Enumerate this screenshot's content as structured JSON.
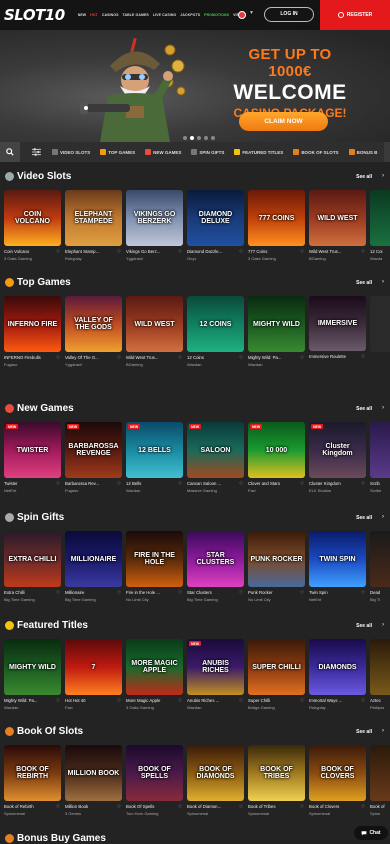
{
  "header": {
    "logo": "SLOT10",
    "nav": [
      "NEW",
      "HOT",
      "CASINOS",
      "TABLE GAMES",
      "LIVE CASINO",
      "JACKPOTS",
      "PROMOTIONS",
      "VIP"
    ],
    "login": "LOG IN",
    "register": "REGISTER"
  },
  "hero": {
    "line1": "GET UP TO 1000€",
    "line2": "WELCOME",
    "line3": "CASINO PACKAGE!",
    "cta": "CLAIM NOW"
  },
  "categories": [
    "VIDEO SLOTS",
    "TOP GAMES",
    "NEW GAMES",
    "SPIN GIFTS",
    "FEATURED TITLES",
    "BOOK OF SLOTS",
    "BONUS B"
  ],
  "see_all": "See all",
  "sections": [
    {
      "title": "Video Slots",
      "icon_color": "#9aa",
      "games": [
        {
          "thumb": "COIN VOLCANO",
          "name": "Coin Volcano",
          "provider": "3 Oaks Gaming",
          "bg": "linear-gradient(#5a1a10,#c03a12,#ffb020)"
        },
        {
          "thumb": "ELEPHANT STAMPEDE",
          "name": "Elephant Stamp...",
          "provider": "Rubyplay",
          "bg": "linear-gradient(#6a3a1a,#c07830,#e0a040)"
        },
        {
          "thumb": "VIKINGS GO BERZERK",
          "name": "Vikings Go Berz...",
          "provider": "Yggdrasil",
          "bg": "linear-gradient(#3a4a6a,#8090b0,#c0c8d8)"
        },
        {
          "thumb": "DIAMOND DELUXE",
          "name": "Diamond Dazzle...",
          "provider": "Onyx",
          "bg": "linear-gradient(#0a1a3a,#1a3a7a,#2050a0)"
        },
        {
          "thumb": "777 COINS",
          "name": "777 Coins",
          "provider": "3 Oaks Gaming",
          "bg": "linear-gradient(#6a1a08,#c0400a,#ff9020)"
        },
        {
          "thumb": "WILD WEST",
          "name": "Wild West Trus...",
          "provider": "BGaming",
          "bg": "linear-gradient(#5a1a12,#9a3a20,#d07040)"
        },
        {
          "thumb": "12",
          "name": "12 Coi",
          "provider": "Wazda",
          "bg": "linear-gradient(#0a3a20,#1a7040)"
        }
      ]
    },
    {
      "title": "Top Games",
      "icon_color": "#f39c12",
      "games": [
        {
          "thumb": "INFERNO FIRE",
          "name": "INFERNO Firebulls",
          "provider": "Fugaso",
          "bg": "linear-gradient(#3a0a0a,#a01a10,#ff5a10)"
        },
        {
          "thumb": "VALLEY OF THE GODS",
          "name": "Valley Of The G...",
          "provider": "Yggdrasil",
          "bg": "linear-gradient(#5a1a3a,#c04a20,#f0a030)"
        },
        {
          "thumb": "WILD WEST",
          "name": "Wild West Trus...",
          "provider": "BGaming",
          "bg": "linear-gradient(#5a1a12,#9a3a20,#d07040)"
        },
        {
          "thumb": "12 COINS",
          "name": "12 Coins",
          "provider": "Wazdan",
          "bg": "linear-gradient(#0a4a3a,#108060,#20b080)"
        },
        {
          "thumb": "MIGHTY WILD",
          "name": "Mighty Wild: Pa...",
          "provider": "Wazdan",
          "bg": "linear-gradient(#0a2a10,#1a5a20,#3a8a30)"
        },
        {
          "thumb": "IMMERSIVE",
          "name": "Immersive Roulette",
          "provider": "",
          "bg": "linear-gradient(#1a0a1a,#3a2a3a,#6a5a6a)",
          "tall": true
        },
        {
          "thumb": "",
          "name": "",
          "provider": "",
          "bg": "#2a2a2a"
        }
      ]
    },
    {
      "title": "New Games",
      "icon_color": "#e74c3c",
      "games": [
        {
          "thumb": "TWISTER",
          "name": "Twister",
          "provider": "NetEnt",
          "bg": "linear-gradient(#3a0a2a,#a01a5a,#e04080)",
          "new": true
        },
        {
          "thumb": "BARBAROSSA REVENGE",
          "name": "Barbarossa Rev...",
          "provider": "Fugaso",
          "bg": "linear-gradient(#1a0a0a,#5a1a10,#a03a1a)",
          "new": true
        },
        {
          "thumb": "12 BELLS",
          "name": "12 Bells",
          "provider": "Wazdan",
          "bg": "linear-gradient(#0a4a6a,#1a8aa0,#40c0d0)",
          "new": true
        },
        {
          "thumb": "SALOON",
          "name": "Cancan Saloon ...",
          "provider": "Massive Gaming",
          "bg": "linear-gradient(#0a3a3a,#1a6a5a,#a04a20)",
          "new": true
        },
        {
          "thumb": "10 000",
          "name": "Clover and Stars",
          "provider": "Fazi",
          "bg": "linear-gradient(#0a5a1a,#1a9a30,#e0c020)",
          "new": true
        },
        {
          "thumb": "Cluster Kingdom",
          "name": "Cluster Kingdom",
          "provider": "ELK Studios",
          "bg": "linear-gradient(#1a1a2a,#3a2a4a,#6a4a5a)",
          "new": true
        },
        {
          "thumb": "",
          "name": "Scrib",
          "provider": "Scribe",
          "bg": "linear-gradient(#2a1a4a,#5a3a8a)"
        }
      ]
    },
    {
      "title": "Spin Gifts",
      "icon_color": "#aaa",
      "games": [
        {
          "thumb": "EXTRA CHILLI",
          "name": "Extra Chilli",
          "provider": "Big Time Gaming",
          "bg": "linear-gradient(#2a1a2a,#6a2a2a,#c03a1a)"
        },
        {
          "thumb": "MILLIONAIRE",
          "name": "Millionaire",
          "provider": "Big Time Gaming",
          "bg": "linear-gradient(#0a0a3a,#1a1a6a,#3a3aa0)"
        },
        {
          "thumb": "FIRE IN THE HOLE",
          "name": "Fire in the Hole ...",
          "provider": "No Limit City",
          "bg": "linear-gradient(#1a0a0a,#5a2a0a,#d06010)"
        },
        {
          "thumb": "STAR CLUSTERS",
          "name": "Star Clusters",
          "provider": "Big Time Gaming",
          "bg": "linear-gradient(#3a0a5a,#8a1a9a,#e040c0)"
        },
        {
          "thumb": "PUNK ROCKER",
          "name": "Punk Rocker",
          "provider": "No Limit City",
          "bg": "linear-gradient(#3a1a0a,#7a4a2a,#4a6a9a)"
        },
        {
          "thumb": "TWIN SPIN",
          "name": "Twin Spin",
          "provider": "NetEnt",
          "bg": "linear-gradient(#0a1a6a,#1a4ac0,#40a0ff)"
        },
        {
          "thumb": "",
          "name": "Dead",
          "provider": "Big Ti",
          "bg": "linear-gradient(#1a1a1a,#4a2a1a)"
        }
      ]
    },
    {
      "title": "Featured Titles",
      "icon_color": "#f1c40f",
      "games": [
        {
          "thumb": "MIGHTY WILD",
          "name": "Mighty Wild: Pa...",
          "provider": "Wazdan",
          "bg": "linear-gradient(#0a2a10,#1a5a20,#3a8a30)"
        },
        {
          "thumb": "7",
          "name": "Hot Hot 40",
          "provider": "Fazi",
          "bg": "linear-gradient(#5a0a0a,#c01a10,#ff8020)"
        },
        {
          "thumb": "MORE MAGIC APPLE",
          "name": "More Magic Apple",
          "provider": "3 Oaks Gaming",
          "bg": "linear-gradient(#0a3a1a,#1a6a2a,#c02a1a)"
        },
        {
          "thumb": "ANUBIS RICHES",
          "name": "Anubis Riches ...",
          "provider": "Wazdan",
          "bg": "linear-gradient(#1a0a3a,#3a1a6a,#c09020)",
          "new": true
        },
        {
          "thumb": "SUPER CHILLI",
          "name": "Super Chilli",
          "provider": "Bridge Gaming",
          "bg": "linear-gradient(#3a1a0a,#8a3a10,#e07020)"
        },
        {
          "thumb": "DIAMONDS",
          "name": "Immortal Ways ...",
          "provider": "Rubyplay",
          "bg": "linear-gradient(#1a0a4a,#3a2a9a,#6a5ae0)"
        },
        {
          "thumb": "",
          "name": "Aztec",
          "provider": "Platipus",
          "bg": "linear-gradient(#2a1a0a,#7a5a1a)"
        }
      ]
    },
    {
      "title": "Book Of Slots",
      "icon_color": "#e67e22",
      "games": [
        {
          "thumb": "BOOK OF REBIRTH",
          "name": "Book of Rebirth",
          "provider": "Spinomenal",
          "bg": "linear-gradient(#2a0a0a,#7a3a10,#e09030)"
        },
        {
          "thumb": "MILLION BOOK",
          "name": "Million Book",
          "provider": "3 Genies",
          "bg": "linear-gradient(#1a0a0a,#4a2a1a,#a07040)"
        },
        {
          "thumb": "BOOK OF SPELLS",
          "name": "Book Of Spells",
          "provider": "Tom Horn Gaming",
          "bg": "linear-gradient(#1a0a2a,#4a1a4a,#8a2a3a)"
        },
        {
          "thumb": "BOOK OF DIAMONDS",
          "name": "Book of Diamon...",
          "provider": "Spinomenal",
          "bg": "linear-gradient(#3a1a0a,#8a5a10,#e0b030)"
        },
        {
          "thumb": "BOOK OF TRIBES",
          "name": "Book of Tribes",
          "provider": "Spinomenal",
          "bg": "linear-gradient(#3a2a0a,#a07a20,#f0d050)"
        },
        {
          "thumb": "BOOK OF CLOVERS",
          "name": "Book of Clovers",
          "provider": "Spinomenal",
          "bg": "linear-gradient(#3a1a0a,#8a4a10,#e0a020)"
        },
        {
          "thumb": "",
          "name": "Book of",
          "provider": "Spino",
          "bg": "linear-gradient(#2a1a0a,#6a3a1a)"
        }
      ]
    },
    {
      "title": "Bonus Buy Games",
      "icon_color": "#e67e22",
      "games": []
    }
  ],
  "chat": "Chat"
}
